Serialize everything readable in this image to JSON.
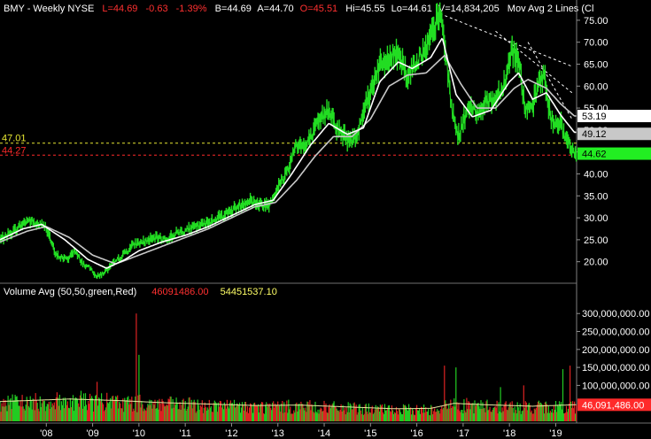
{
  "header": {
    "ticker": "BMY - Weekly  NYSE",
    "last": "L=44.69",
    "change": "-0.63",
    "pct": "-1.39%",
    "bid": "B=44.69",
    "ask": "A=44.70",
    "open": "O=45.51",
    "high": "Hi=45.55",
    "low": "Lo=44.61",
    "volume": "V=14,834,205",
    "ma_label": "Mov Avg 2 Lines (Cl"
  },
  "volume_header": {
    "label": "Volume Avg (50,50,green,Red)",
    "avg1": "46091486.00",
    "avg2": "54451537.10"
  },
  "colors": {
    "background": "#000000",
    "price": "#22dd22",
    "ma_white": "#ffffff",
    "ma_gray": "#c8c8c8",
    "up_volume": "#22cc22",
    "down_volume": "#dd2222",
    "avg_line": "#e6e6a0",
    "yellow_level": "#e6e632",
    "red_level": "#ff2a2a"
  },
  "chart_data": [
    {
      "type": "line",
      "x_ticks": [
        "'08",
        "'09",
        "'10",
        "'11",
        "'12",
        "'13",
        "'14",
        "'15",
        "'16",
        "'17",
        "'18",
        "'19"
      ],
      "x_tick_years": [
        2008,
        2009,
        2010,
        2011,
        2012,
        2013,
        2014,
        2015,
        2016,
        2017,
        2018,
        2019
      ],
      "x_range": [
        2007.0,
        2019.45
      ],
      "y_ticks": [
        "75.00",
        "70.00",
        "65.00",
        "60.00",
        "55.00",
        "50.00",
        "45.00",
        "40.00",
        "35.00",
        "30.00",
        "25.00",
        "20.00"
      ],
      "ylim": [
        15.5,
        78
      ],
      "grid": false,
      "price_anchors": [
        [
          2007.0,
          25.0
        ],
        [
          2007.3,
          27.0
        ],
        [
          2007.6,
          29.5
        ],
        [
          2007.8,
          28.5
        ],
        [
          2008.0,
          28.0
        ],
        [
          2008.2,
          21.5
        ],
        [
          2008.45,
          20.5
        ],
        [
          2008.6,
          22.5
        ],
        [
          2008.8,
          19.5
        ],
        [
          2009.0,
          18.0
        ],
        [
          2009.1,
          16.5
        ],
        [
          2009.3,
          18.0
        ],
        [
          2009.5,
          20.0
        ],
        [
          2009.7,
          22.0
        ],
        [
          2009.9,
          24.0
        ],
        [
          2010.1,
          24.5
        ],
        [
          2010.4,
          25.5
        ],
        [
          2010.6,
          25.0
        ],
        [
          2010.8,
          26.5
        ],
        [
          2011.1,
          27.5
        ],
        [
          2011.4,
          28.5
        ],
        [
          2011.7,
          30.0
        ],
        [
          2011.9,
          31.0
        ],
        [
          2012.2,
          33.0
        ],
        [
          2012.4,
          34.0
        ],
        [
          2012.6,
          33.0
        ],
        [
          2012.8,
          33.0
        ],
        [
          2012.95,
          36.0
        ],
        [
          2013.1,
          38.5
        ],
        [
          2013.25,
          42.0
        ],
        [
          2013.4,
          47.0
        ],
        [
          2013.6,
          46.0
        ],
        [
          2013.8,
          50.0
        ],
        [
          2013.9,
          52.0
        ],
        [
          2014.1,
          55.0
        ],
        [
          2014.3,
          50.0
        ],
        [
          2014.55,
          47.5
        ],
        [
          2014.7,
          48.5
        ],
        [
          2014.85,
          55.0
        ],
        [
          2015.0,
          58.5
        ],
        [
          2015.15,
          64.0
        ],
        [
          2015.4,
          66.0
        ],
        [
          2015.6,
          68.0
        ],
        [
          2015.8,
          62.0
        ],
        [
          2016.0,
          66.0
        ],
        [
          2016.2,
          68.0
        ],
        [
          2016.4,
          74.0
        ],
        [
          2016.5,
          76.5
        ],
        [
          2016.6,
          70.0
        ],
        [
          2016.75,
          55.0
        ],
        [
          2016.9,
          48.5
        ],
        [
          2017.1,
          55.0
        ],
        [
          2017.3,
          54.0
        ],
        [
          2017.5,
          56.5
        ],
        [
          2017.7,
          57.0
        ],
        [
          2017.9,
          61.0
        ],
        [
          2018.05,
          68.5
        ],
        [
          2018.2,
          66.0
        ],
        [
          2018.35,
          54.0
        ],
        [
          2018.5,
          55.0
        ],
        [
          2018.65,
          61.5
        ],
        [
          2018.75,
          62.5
        ],
        [
          2018.85,
          55.0
        ],
        [
          2018.95,
          51.0
        ],
        [
          2019.1,
          52.5
        ],
        [
          2019.2,
          47.5
        ],
        [
          2019.3,
          47.0
        ],
        [
          2019.35,
          45.0
        ],
        [
          2019.4,
          44.7
        ]
      ],
      "ma_fast_anchors": [
        [
          2007.0,
          25.0
        ],
        [
          2007.5,
          27.5
        ],
        [
          2007.9,
          28.5
        ],
        [
          2008.4,
          25.0
        ],
        [
          2008.9,
          20.5
        ],
        [
          2009.3,
          18.5
        ],
        [
          2009.7,
          20.5
        ],
        [
          2010.0,
          22.5
        ],
        [
          2010.5,
          24.5
        ],
        [
          2011.0,
          26.0
        ],
        [
          2011.5,
          28.0
        ],
        [
          2012.0,
          30.5
        ],
        [
          2012.5,
          33.0
        ],
        [
          2012.9,
          34.0
        ],
        [
          2013.3,
          40.0
        ],
        [
          2013.7,
          46.5
        ],
        [
          2014.1,
          51.5
        ],
        [
          2014.5,
          49.0
        ],
        [
          2014.85,
          50.5
        ],
        [
          2015.2,
          61.0
        ],
        [
          2015.6,
          65.5
        ],
        [
          2015.9,
          64.0
        ],
        [
          2016.3,
          66.5
        ],
        [
          2016.55,
          71.0
        ],
        [
          2016.85,
          58.0
        ],
        [
          2017.2,
          53.0
        ],
        [
          2017.6,
          54.5
        ],
        [
          2018.0,
          61.0
        ],
        [
          2018.2,
          63.0
        ],
        [
          2018.5,
          57.0
        ],
        [
          2018.8,
          58.5
        ],
        [
          2019.1,
          53.5
        ],
        [
          2019.4,
          49.5
        ]
      ],
      "ma_slow_anchors": [
        [
          2007.0,
          24.5
        ],
        [
          2007.6,
          27.0
        ],
        [
          2008.0,
          28.0
        ],
        [
          2008.5,
          25.5
        ],
        [
          2009.0,
          21.5
        ],
        [
          2009.5,
          19.5
        ],
        [
          2010.0,
          21.5
        ],
        [
          2010.5,
          23.5
        ],
        [
          2011.0,
          25.5
        ],
        [
          2011.5,
          27.5
        ],
        [
          2012.0,
          30.0
        ],
        [
          2012.5,
          32.5
        ],
        [
          2012.95,
          33.5
        ],
        [
          2013.4,
          38.5
        ],
        [
          2013.8,
          44.0
        ],
        [
          2014.2,
          48.5
        ],
        [
          2014.6,
          48.5
        ],
        [
          2015.0,
          52.5
        ],
        [
          2015.4,
          60.0
        ],
        [
          2015.8,
          62.5
        ],
        [
          2016.2,
          63.0
        ],
        [
          2016.6,
          67.0
        ],
        [
          2016.95,
          60.5
        ],
        [
          2017.3,
          55.0
        ],
        [
          2017.7,
          55.0
        ],
        [
          2018.1,
          59.5
        ],
        [
          2018.4,
          61.5
        ],
        [
          2018.8,
          59.5
        ],
        [
          2019.1,
          56.0
        ],
        [
          2019.4,
          53.2
        ]
      ],
      "trendlines": [
        {
          "from": [
            2016.5,
            76.5
          ],
          "to": [
            2019.35,
            64.5
          ]
        },
        {
          "from": [
            2017.7,
            72.5
          ],
          "to": [
            2019.35,
            58.5
          ]
        },
        {
          "from": [
            2018.4,
            70.0
          ],
          "to": [
            2019.35,
            52.5
          ]
        }
      ],
      "levels": [
        {
          "value": 47.01,
          "label": "47.01",
          "color": "yellow"
        },
        {
          "value": 44.27,
          "label": "44.27",
          "color": "red"
        }
      ],
      "price_tags": [
        {
          "value": 53.19,
          "label": "53.19",
          "style": "white"
        },
        {
          "value": 49.12,
          "label": "49.12",
          "style": "gray"
        },
        {
          "value": 44.62,
          "label": "44.62",
          "style": "green"
        }
      ]
    },
    {
      "type": "bar",
      "series_name": "Volume",
      "y_ticks": [
        "300,000,000.00",
        "250,000,000.00",
        "200,000,000.00",
        "150,000,000.00",
        "100,000,000.00"
      ],
      "ylim": [
        0,
        340000000
      ],
      "avg_tag": "46,091,486.00",
      "avg_anchors": [
        [
          2007.0,
          55000000
        ],
        [
          2008.5,
          62000000
        ],
        [
          2009.5,
          58000000
        ],
        [
          2010.5,
          52000000
        ],
        [
          2011.5,
          48000000
        ],
        [
          2012.5,
          44000000
        ],
        [
          2013.5,
          45000000
        ],
        [
          2014.5,
          40000000
        ],
        [
          2015.5,
          35000000
        ],
        [
          2016.3,
          36000000
        ],
        [
          2016.8,
          50000000
        ],
        [
          2017.5,
          46000000
        ],
        [
          2018.5,
          42000000
        ],
        [
          2019.4,
          46000000
        ]
      ],
      "spikes": [
        [
          2009.95,
          300000000,
          "down"
        ],
        [
          2010.0,
          185000000,
          "up"
        ],
        [
          2009.1,
          110000000,
          "down"
        ],
        [
          2008.75,
          85000000,
          "up"
        ],
        [
          2016.6,
          155000000,
          "down"
        ],
        [
          2016.85,
          150000000,
          "up"
        ],
        [
          2018.3,
          100000000,
          "down"
        ],
        [
          2019.15,
          145000000,
          "up"
        ],
        [
          2019.3,
          155000000,
          "down"
        ],
        [
          2017.8,
          95000000,
          "up"
        ]
      ]
    }
  ]
}
